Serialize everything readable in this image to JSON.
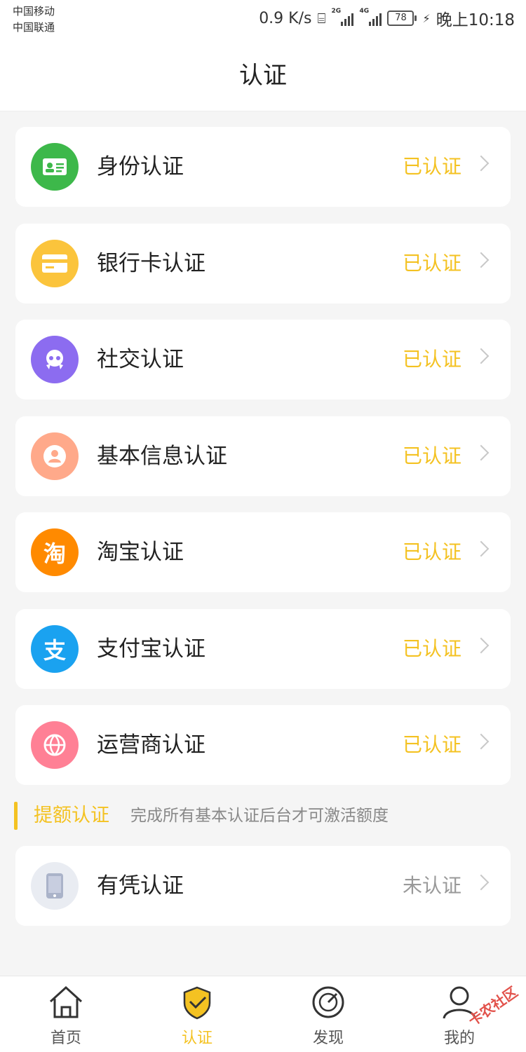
{
  "status_bar": {
    "carrier1": "中国移动",
    "carrier2": "中国联通",
    "speed": "0.9 K/s",
    "net1": "2G",
    "net2": "4G",
    "battery": "78",
    "time": "晚上10:18"
  },
  "header": {
    "title": "认证"
  },
  "items": [
    {
      "label": "身份认证",
      "status": "已认证",
      "icon": "id-card-icon",
      "color": "#3db84a"
    },
    {
      "label": "银行卡认证",
      "status": "已认证",
      "icon": "bank-card-icon",
      "color": "#fbc43c"
    },
    {
      "label": "社交认证",
      "status": "已认证",
      "icon": "social-icon",
      "color": "#8c6cf0"
    },
    {
      "label": "基本信息认证",
      "status": "已认证",
      "icon": "user-info-icon",
      "color": "#ffa98a"
    },
    {
      "label": "淘宝认证",
      "status": "已认证",
      "icon": "taobao-icon",
      "color": "#ff8a00",
      "glyph": "淘"
    },
    {
      "label": "支付宝认证",
      "status": "已认证",
      "icon": "alipay-icon",
      "color": "#1aa2f0",
      "glyph": "支"
    },
    {
      "label": "运营商认证",
      "status": "已认证",
      "icon": "carrier-globe-icon",
      "color": "#ff8095"
    }
  ],
  "section": {
    "title": "提额认证",
    "hint": "完成所有基本认证后台才可激活额度"
  },
  "extra_item": {
    "label": "有凭认证",
    "status": "未认证",
    "icon": "phone-icon",
    "color": "#e9ecf2"
  },
  "tabs": [
    {
      "label": "首页",
      "icon": "home-icon"
    },
    {
      "label": "认证",
      "icon": "shield-check-icon",
      "active": true
    },
    {
      "label": "发现",
      "icon": "compass-icon"
    },
    {
      "label": "我的",
      "icon": "user-icon"
    }
  ],
  "watermark": "卡农社区",
  "accent": "#f4c222"
}
